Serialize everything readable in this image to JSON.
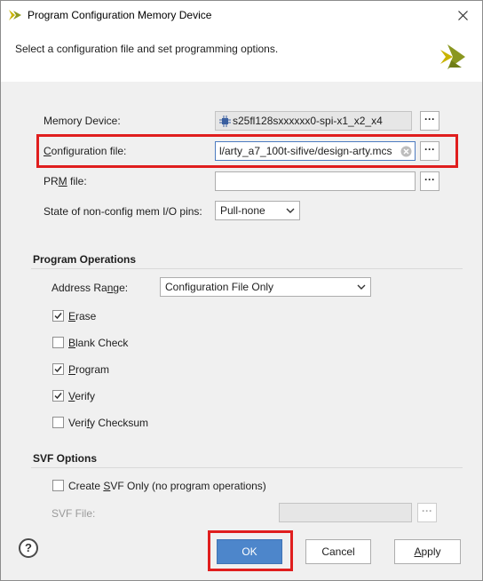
{
  "window": {
    "title": "Program Configuration Memory Device"
  },
  "header": {
    "description": "Select a configuration file and set programming options."
  },
  "form": {
    "memory_device": {
      "label": "Memory Device:",
      "value": "s25fl128sxxxxxx0-spi-x1_x2_x4"
    },
    "config_file": {
      "label_u": "C",
      "label_rest": "onfiguration file:",
      "value": "l/arty_a7_100t-sifive/design-arty.mcs"
    },
    "prm_file": {
      "label_a": "PR",
      "label_u": "M",
      "label_b": " file:",
      "value": ""
    },
    "io_state": {
      "label": "State of non-config mem I/O pins:",
      "value": "Pull-none"
    },
    "browse_label": "···"
  },
  "program_operations": {
    "title": "Program Operations",
    "address_range": {
      "label_a": "Address Ra",
      "label_u": "n",
      "label_b": "ge:",
      "value": "Configuration File Only"
    },
    "erase": {
      "label_u": "E",
      "label_rest": "rase",
      "checked": true
    },
    "blank_check": {
      "label_u": "B",
      "label_rest": "lank Check",
      "checked": false
    },
    "program": {
      "label_u": "P",
      "label_rest": "rogram",
      "checked": true
    },
    "verify": {
      "label_u": "V",
      "label_rest": "erify",
      "checked": true
    },
    "verify_checksum": {
      "label_a": "Veri",
      "label_u": "f",
      "label_b": "y Checksum",
      "checked": false
    }
  },
  "svf_options": {
    "title": "SVF Options",
    "create_svf": {
      "label_a": "Create ",
      "label_u": "S",
      "label_b": "VF Only (no program operations)",
      "checked": false
    },
    "svf_file": {
      "label": "SVF File:",
      "value": ""
    }
  },
  "buttons": {
    "help": "?",
    "ok": "OK",
    "cancel": "Cancel",
    "apply_u": "A",
    "apply_rest": "pply"
  },
  "colors": {
    "highlight": "#e01e1e",
    "primary_button": "#4d86cb",
    "focus_border": "#4d7cc0"
  }
}
